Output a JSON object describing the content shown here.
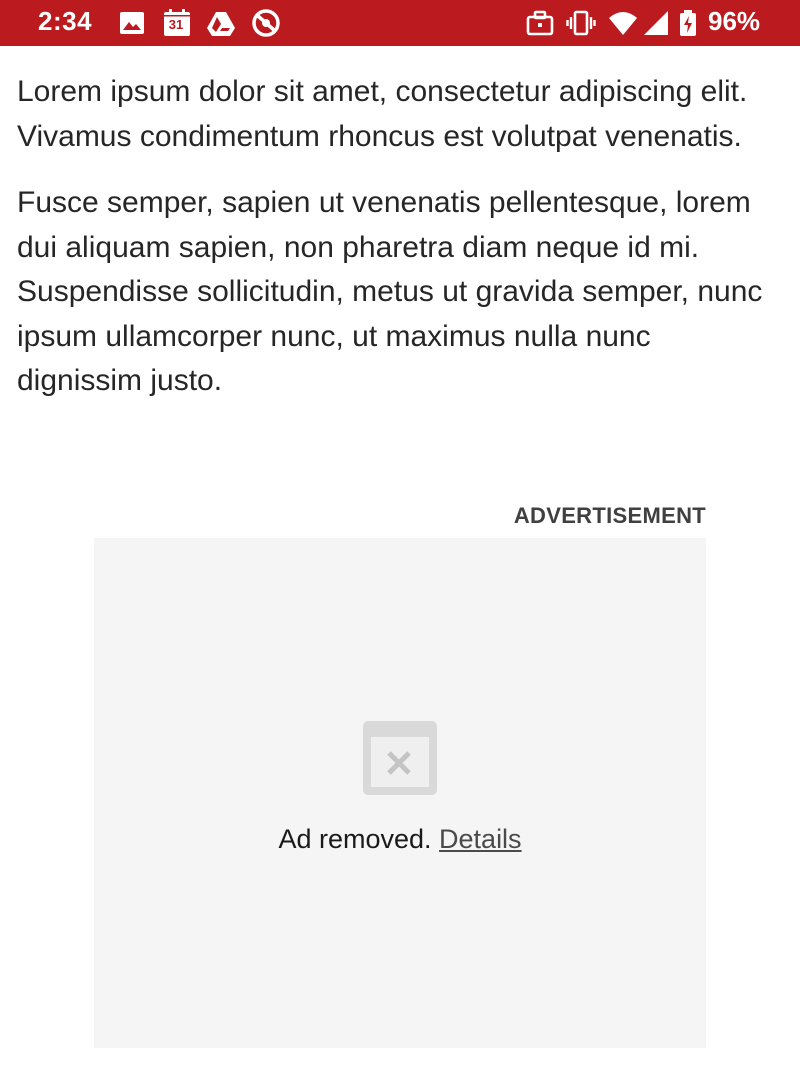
{
  "status_bar": {
    "time": "2:34",
    "calendar_date": "31",
    "battery_percent": "96%",
    "background_color": "#bb1a1f",
    "left_icons": [
      "gallery-icon",
      "calendar-icon",
      "drive-icon",
      "do-not-disturb-icon"
    ],
    "right_icons": [
      "work-profile-icon",
      "vibrate-icon",
      "wifi-icon",
      "cellular-signal-icon",
      "battery-charging-icon"
    ]
  },
  "article": {
    "paragraphs": [
      "Lorem ipsum dolor sit amet, consectetur adipiscing elit. Vivamus condimentum rhoncus est volutpat venenatis.",
      "Fusce semper, sapien ut venenatis pellentesque, lorem dui aliquam sapien, non pharetra diam neque id mi. Suspendisse sollicitudin, metus ut gravida semper, nunc ipsum ullamcorper nunc, ut maximus nulla nunc dignissim justo."
    ]
  },
  "ad": {
    "label": "ADVERTISEMENT",
    "removed_text": "Ad removed.",
    "details_link": "Details",
    "icon": "ad-removed-icon"
  }
}
